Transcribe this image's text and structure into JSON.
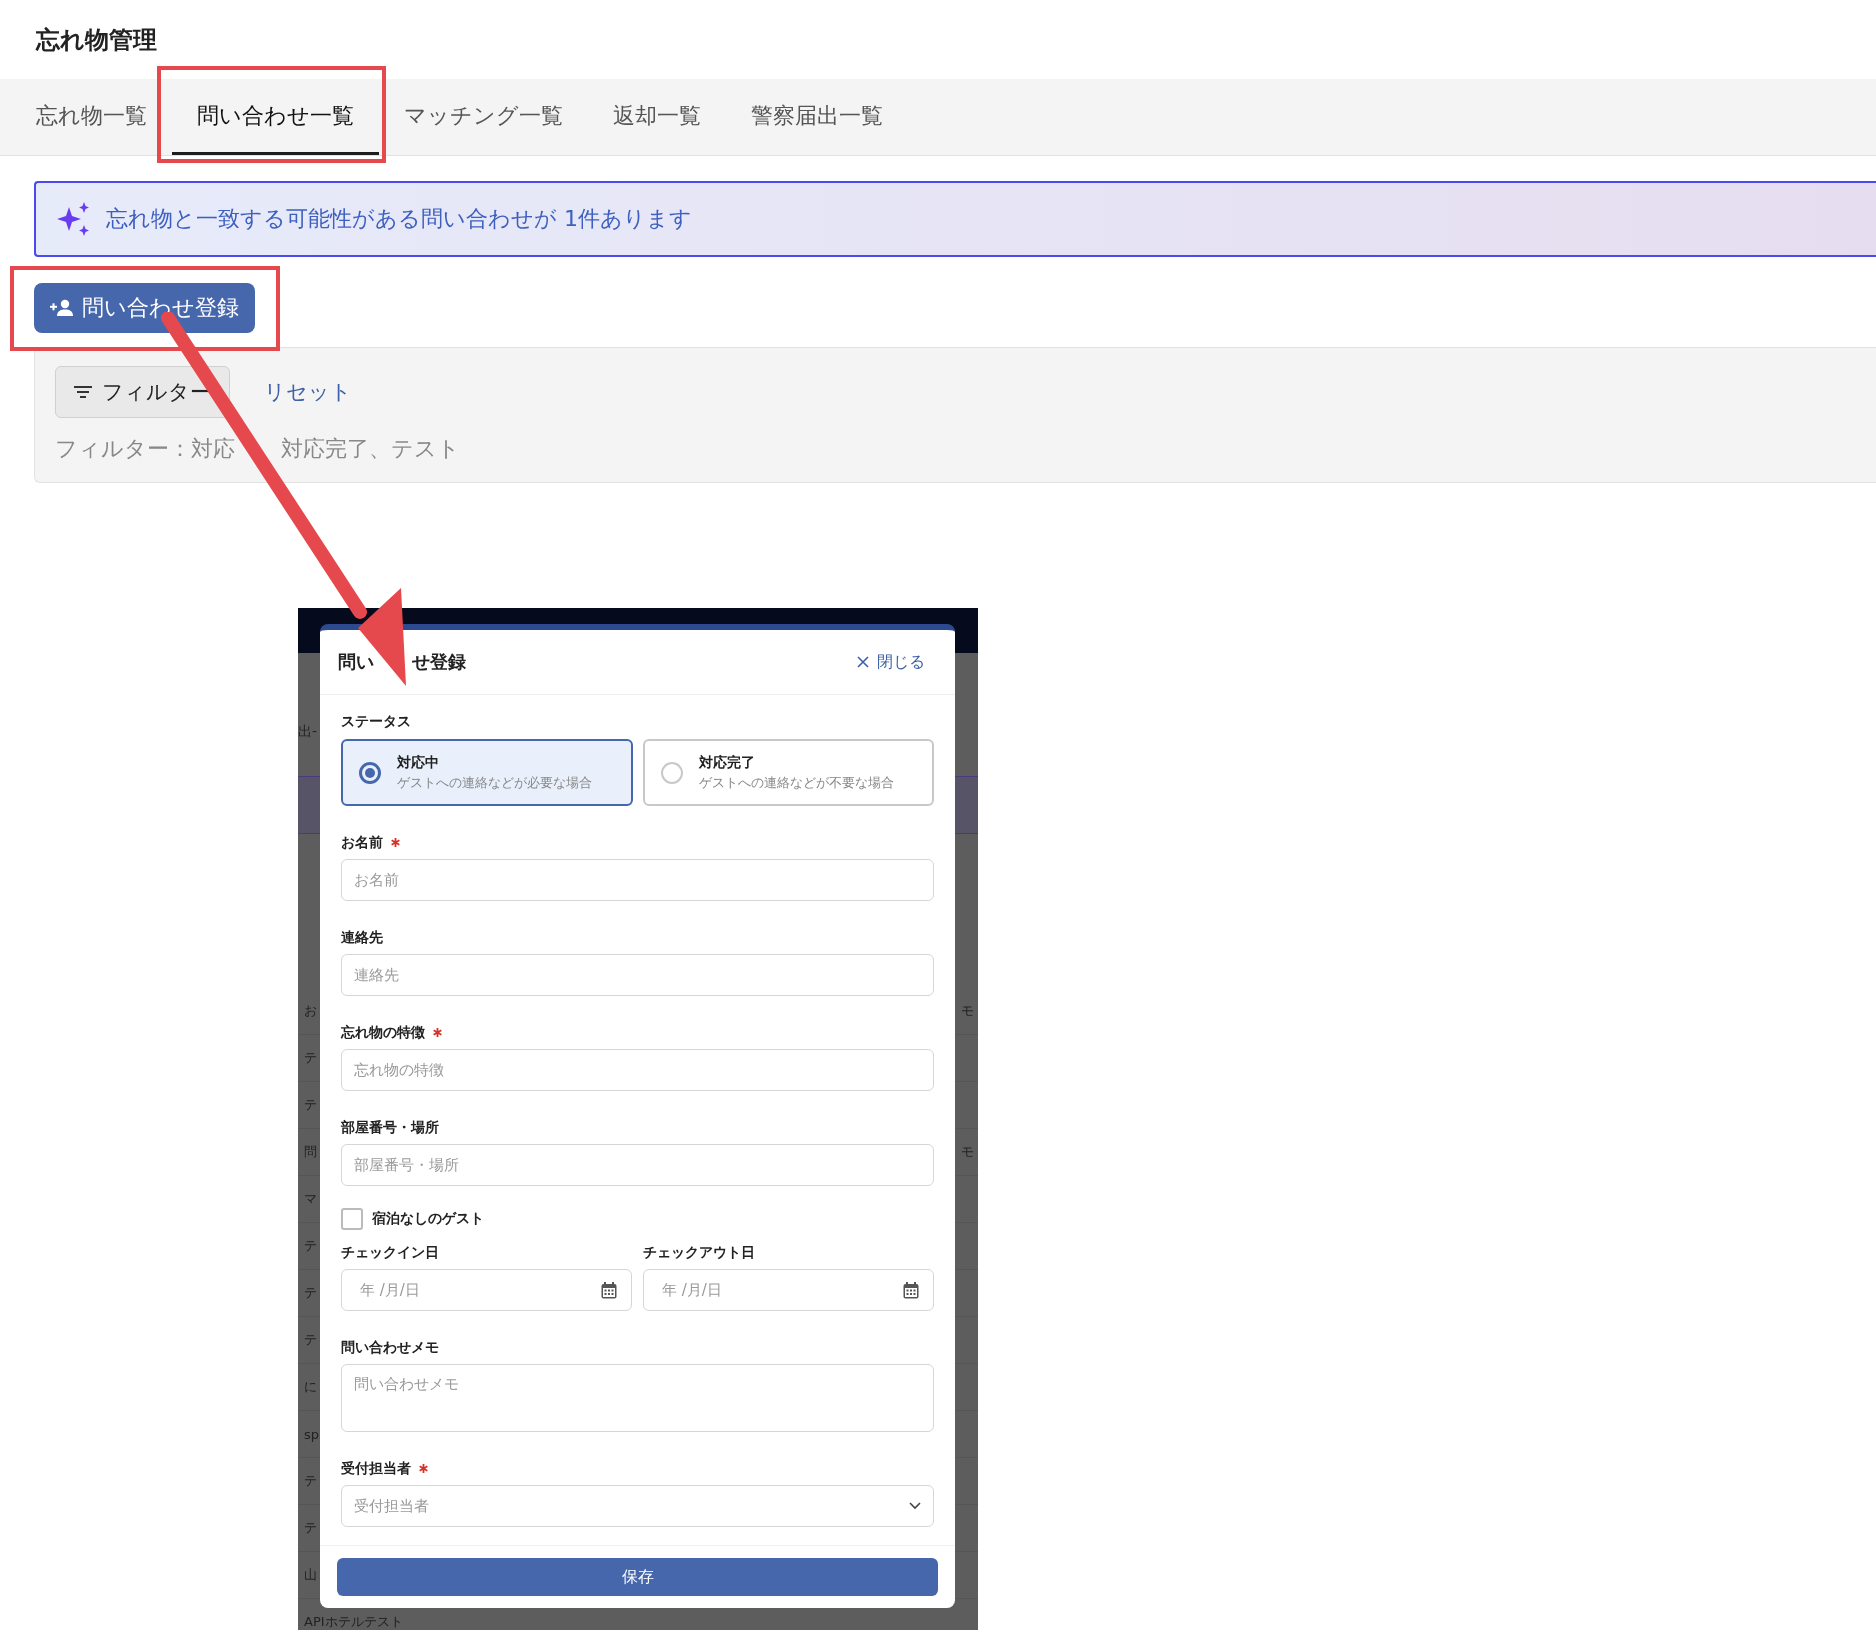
{
  "app_title": "忘れ物管理",
  "tabs": [
    {
      "label": "忘れ物一覧",
      "selected": false
    },
    {
      "label": "問い合わせ一覧",
      "selected": true
    },
    {
      "label": "マッチング一覧",
      "selected": false
    },
    {
      "label": "返却一覧",
      "selected": false
    },
    {
      "label": "警察届出一覧",
      "selected": false
    }
  ],
  "notice": {
    "text": "忘れ物と一致する可能性がある問い合わせが 1件あります"
  },
  "register_button": {
    "label": "問い合わせ登録"
  },
  "filter": {
    "button": "フィルター",
    "reset": "リセット",
    "summary_parts": [
      "フィルター：対応",
      "対応完了、テスト"
    ]
  },
  "embedded_screenshot": {
    "background_tab_fragment": "出-",
    "background_rows": [
      {
        "left": "お",
        "right": "モ"
      },
      {
        "left": "テ"
      },
      {
        "left": "テ"
      },
      {
        "left": "問",
        "right": "モ"
      },
      {
        "left": "マ"
      },
      {
        "left": "テ"
      },
      {
        "left": "テ"
      },
      {
        "left": "テ"
      },
      {
        "left": "に"
      },
      {
        "left": "sp"
      },
      {
        "left": "テ"
      },
      {
        "left": "テ"
      },
      {
        "left": "山"
      },
      {
        "left": "APIホテルテスト"
      }
    ],
    "modal": {
      "title_parts": [
        "問い",
        "せ登録"
      ],
      "close": "閉じる",
      "status_label": "ステータス",
      "status_options": [
        {
          "label": "対応中",
          "description": "ゲストへの連絡などが必要な場合",
          "selected": true
        },
        {
          "label": "対応完了",
          "description": "ゲストへの連絡などが不要な場合",
          "selected": false
        }
      ],
      "fields": [
        {
          "kind": "text",
          "label": "お名前",
          "required": true,
          "placeholder": "お名前"
        },
        {
          "kind": "text",
          "label": "連絡先",
          "required": false,
          "placeholder": "連絡先"
        },
        {
          "kind": "text",
          "label": "忘れ物の特徴",
          "required": true,
          "placeholder": "忘れ物の特徴"
        },
        {
          "kind": "text",
          "label": "部屋番号・場所",
          "required": false,
          "placeholder": "部屋番号・場所"
        },
        {
          "kind": "checkbox",
          "label": "宿泊なしのゲスト",
          "checked": false
        },
        {
          "kind": "date_pair",
          "items": [
            {
              "label": "チェックイン日",
              "placeholder": "年 /月/日"
            },
            {
              "label": "チェックアウト日",
              "placeholder": "年 /月/日"
            }
          ]
        },
        {
          "kind": "textarea",
          "label": "問い合わせメモ",
          "required": false,
          "placeholder": "問い合わせメモ"
        },
        {
          "kind": "select",
          "label": "受付担当者",
          "required": true,
          "placeholder": "受付担当者"
        }
      ],
      "save": "保存"
    }
  }
}
